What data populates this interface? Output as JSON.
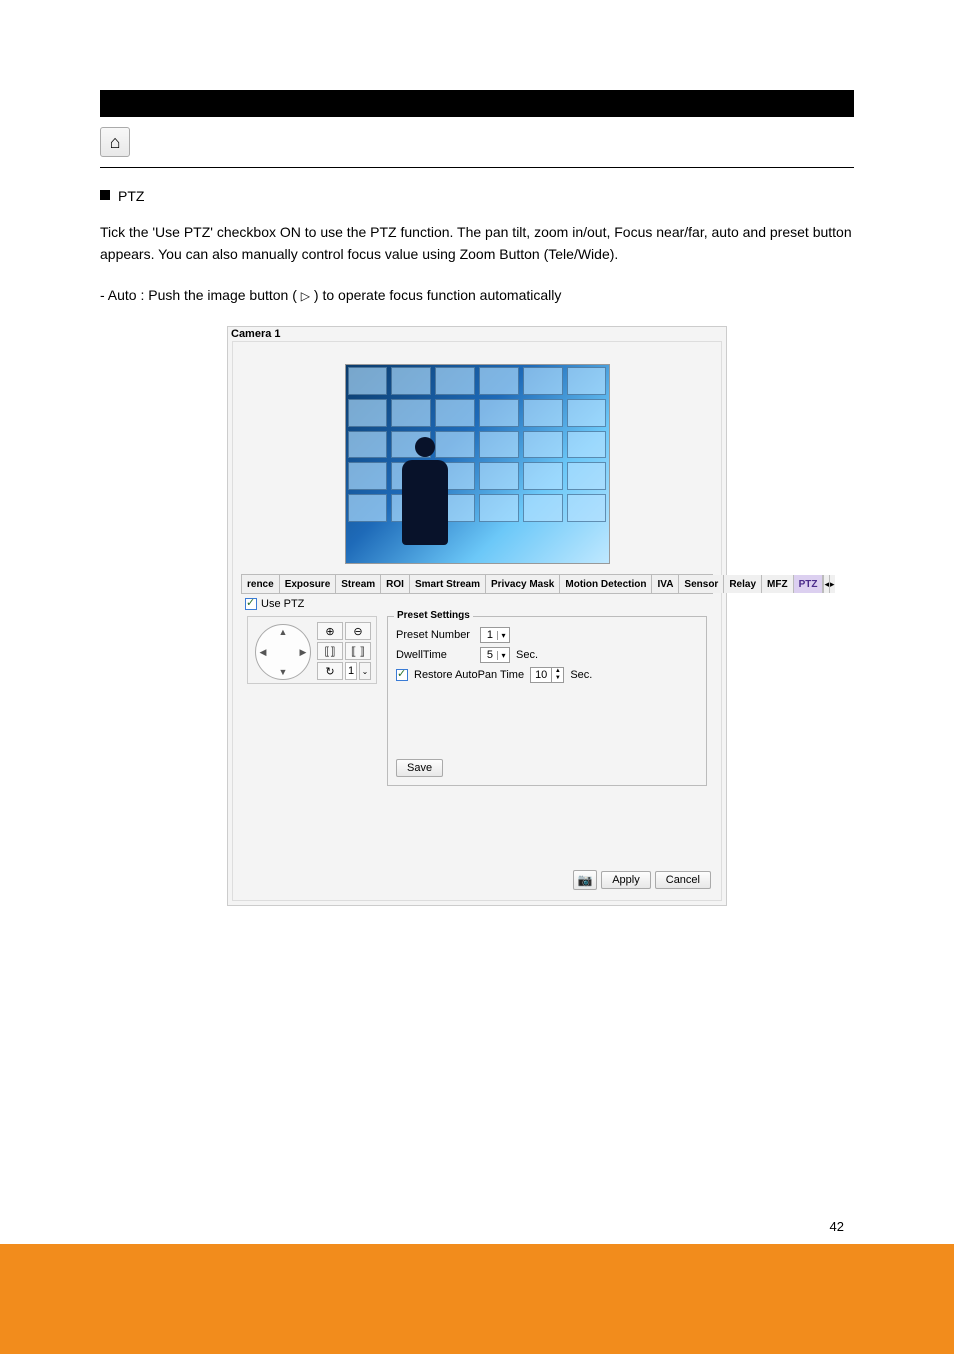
{
  "doc": {
    "bullet_text": "PTZ",
    "paragraph": "Tick the 'Use PTZ' checkbox ON to use the PTZ function. The pan tilt, zoom in/out, Focus near/far, auto and preset button appears. You can also manually control focus value using Zoom Button (Tele/Wide).",
    "auto_line_prefix": " - Auto : Push the image button (",
    "auto_line_suffix": ") to operate focus function automatically",
    "page_number": "42"
  },
  "screenshot": {
    "title": "Camera 1",
    "tabs": {
      "scroll_left": "◂",
      "items": [
        "rence",
        "Exposure",
        "Stream",
        "ROI",
        "Smart Stream",
        "Privacy Mask",
        "Motion Detection",
        "IVA",
        "Sensor",
        "Relay",
        "MFZ",
        "PTZ"
      ],
      "active_index": 11,
      "scroll_right": "▸"
    },
    "use_ptz_label": "Use PTZ",
    "ptz_pad": {
      "zoom_in": "⊕",
      "zoom_out": "⊖",
      "focus_near": "⟦⟧",
      "focus_far": "⟦ ⟧",
      "auto": "↻",
      "preset_num": "1",
      "step": "⌄"
    },
    "preset": {
      "legend": "Preset Settings",
      "number_label": "Preset Number",
      "number_value": "1",
      "dwell_label": "DwellTime",
      "dwell_value": "5",
      "sec": "Sec.",
      "restore_label": "Restore AutoPan Time",
      "restore_value": "10",
      "save": "Save"
    },
    "footer": {
      "cam_icon": "📷",
      "apply": "Apply",
      "cancel": "Cancel"
    }
  }
}
